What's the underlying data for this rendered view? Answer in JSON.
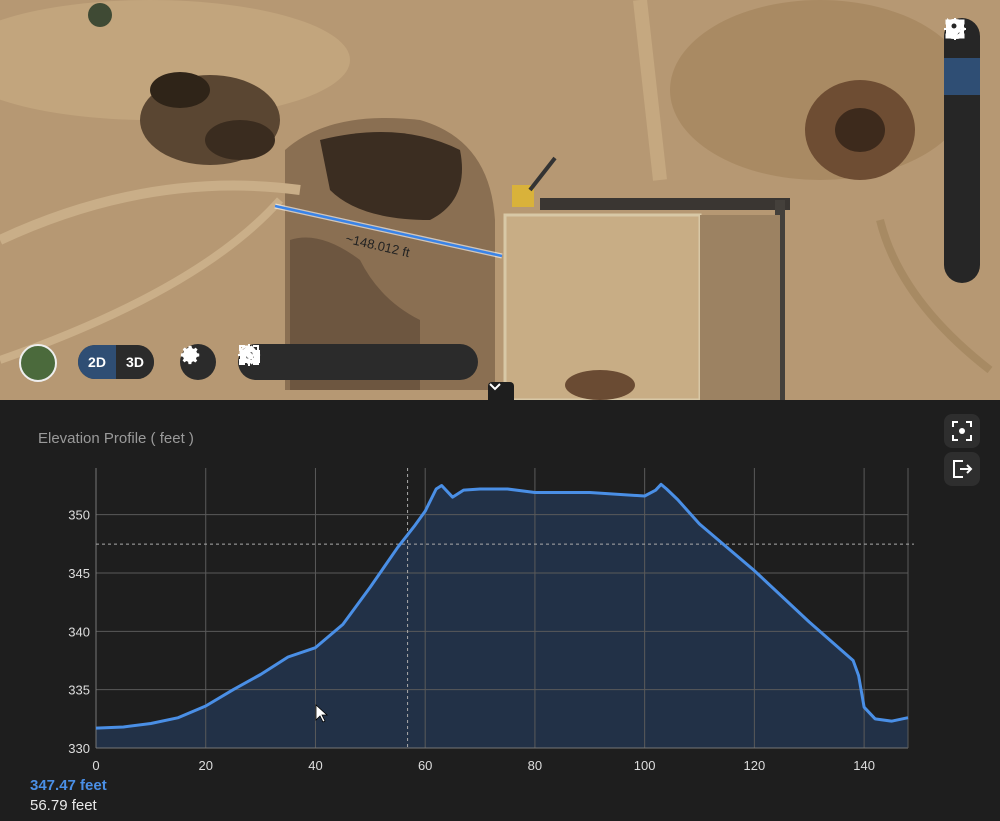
{
  "map": {
    "measurement_label": "~148.012 ft",
    "view_toggle": {
      "option_2d": "2D",
      "option_3d": "3D",
      "selected": "2D"
    }
  },
  "toolbar_right": [
    {
      "icon": "pointer-icon",
      "active": false
    },
    {
      "icon": "line-measure-icon",
      "active": true
    },
    {
      "icon": "area-measure-icon",
      "active": false
    },
    {
      "icon": "circle-measure-icon",
      "active": false
    },
    {
      "icon": "volume-measure-icon",
      "active": false
    },
    {
      "icon": "location-pin-icon",
      "active": false
    },
    {
      "icon": "crosshair-icon",
      "active": false
    }
  ],
  "toolbar_bottom": [
    "compare-view-icon",
    "camera-icon",
    "locate-icon",
    "fit-extent-icon",
    "zoom-in-icon",
    "zoom-out-icon"
  ],
  "profile": {
    "title": "Elevation Profile ( feet )",
    "readout_elevation": "347.47 feet",
    "readout_distance": "56.79 feet"
  },
  "chart_data": {
    "type": "area",
    "title": "Elevation Profile ( feet )",
    "xlim": [
      0,
      148
    ],
    "ylim": [
      330,
      354
    ],
    "xticks": [
      0,
      20,
      40,
      60,
      80,
      100,
      120,
      140
    ],
    "yticks": [
      330,
      335,
      340,
      345,
      350
    ],
    "grid": true,
    "cursor": {
      "x": 56.79,
      "y": 347.47
    },
    "x": [
      0,
      5,
      10,
      15,
      20,
      25,
      30,
      35,
      40,
      45,
      50,
      55,
      58,
      60,
      62,
      63,
      65,
      67,
      70,
      75,
      80,
      90,
      100,
      102,
      103,
      104,
      106,
      110,
      120,
      130,
      138,
      139,
      140,
      142,
      145,
      148
    ],
    "y": [
      331.7,
      331.8,
      332.1,
      332.6,
      333.6,
      335.0,
      336.3,
      337.8,
      338.6,
      340.6,
      343.8,
      347.2,
      349.0,
      350.3,
      352.2,
      352.5,
      351.5,
      352.1,
      352.2,
      352.2,
      351.9,
      351.9,
      351.6,
      352.1,
      352.6,
      352.2,
      351.3,
      349.2,
      345.2,
      340.8,
      337.5,
      336.2,
      333.5,
      332.5,
      332.3,
      332.6
    ]
  }
}
